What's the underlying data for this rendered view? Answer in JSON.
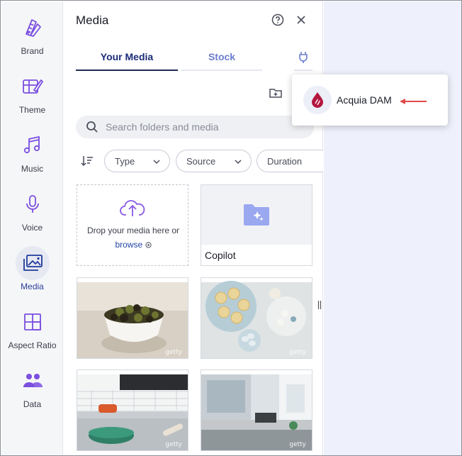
{
  "sidebar": {
    "items": [
      {
        "label": "Brand",
        "icon": "brand-palette-icon"
      },
      {
        "label": "Theme",
        "icon": "theme-icon"
      },
      {
        "label": "Music",
        "icon": "music-note-icon"
      },
      {
        "label": "Voice",
        "icon": "microphone-icon"
      },
      {
        "label": "Media",
        "icon": "media-images-icon",
        "active": true
      },
      {
        "label": "Aspect Ratio",
        "icon": "aspect-ratio-icon"
      },
      {
        "label": "Data",
        "icon": "data-people-icon"
      }
    ]
  },
  "panel": {
    "title": "Media",
    "tabs": [
      {
        "label": "Your Media",
        "active": true
      },
      {
        "label": "Stock",
        "active": false
      }
    ],
    "search": {
      "placeholder": "Search folders and media"
    },
    "filters": [
      {
        "label": "Type"
      },
      {
        "label": "Source"
      },
      {
        "label": "Duration"
      }
    ],
    "dropzone": {
      "text": "Drop your media here or",
      "link": "browse"
    },
    "folder": {
      "label": "Copilot"
    },
    "thumbnails": [
      {
        "watermark": "getty"
      },
      {
        "watermark": "getty"
      },
      {
        "watermark": "getty"
      },
      {
        "watermark": "getty"
      }
    ]
  },
  "popover": {
    "item_label": "Acquia DAM"
  },
  "colors": {
    "accent": "#1a2c78",
    "icon_purple": "#7b4fe0",
    "canvas_bg": "#eef0fb",
    "arrow_red": "#e04a4a"
  }
}
